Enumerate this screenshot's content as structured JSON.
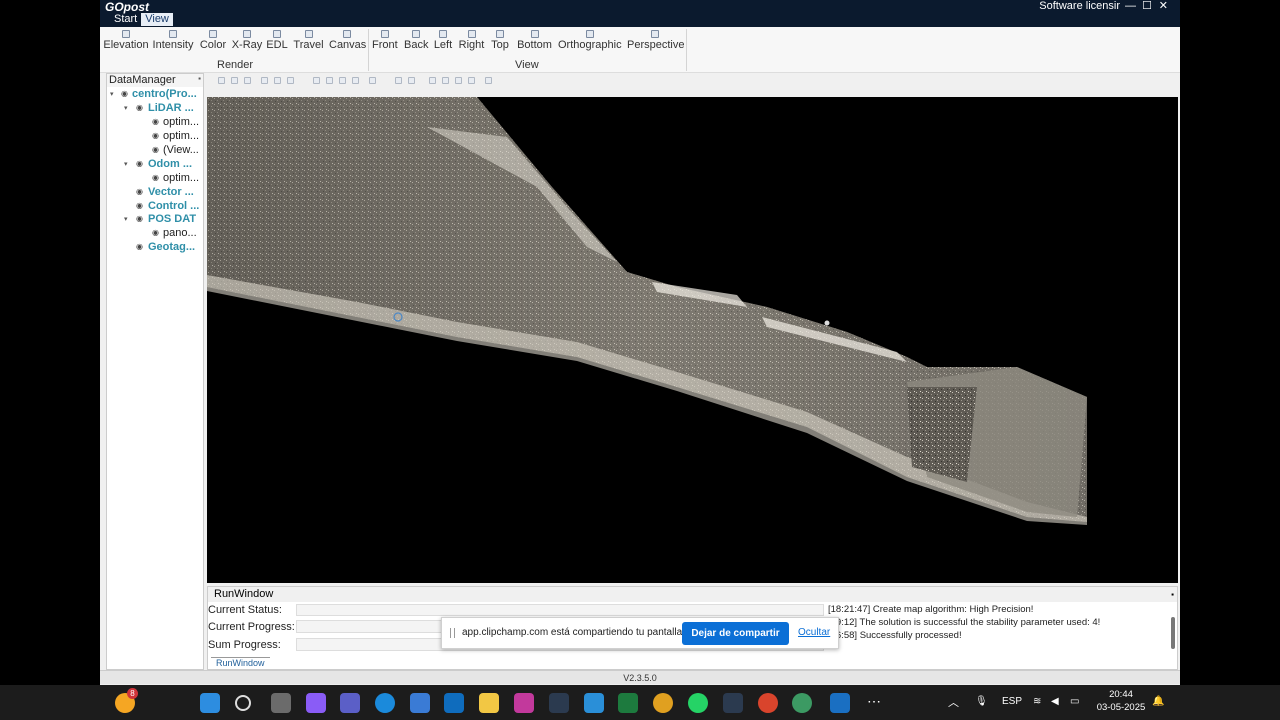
{
  "app": {
    "title": "GOpost",
    "license": "Software licensir",
    "version": "V2.3.5.0"
  },
  "menu_tabs": [
    {
      "label": "Start"
    },
    {
      "label": "View"
    }
  ],
  "ribbon": {
    "render_group_label": "Render",
    "view_group_label": "View",
    "render_buttons": [
      {
        "label": "Elevation",
        "icon": "elevation-icon"
      },
      {
        "label": "Intensity",
        "icon": "intensity-icon"
      },
      {
        "label": "Color",
        "icon": "color-icon"
      },
      {
        "label": "X-Ray",
        "icon": "xray-icon"
      },
      {
        "label": "EDL",
        "icon": "edl-icon"
      },
      {
        "label": "Travel",
        "icon": "travel-icon"
      },
      {
        "label": "Canvas",
        "icon": "canvas-icon"
      }
    ],
    "view_buttons": [
      {
        "label": "Front",
        "icon": "front-view-icon"
      },
      {
        "label": "Back",
        "icon": "back-view-icon"
      },
      {
        "label": "Left",
        "icon": "left-view-icon"
      },
      {
        "label": "Right",
        "icon": "right-view-icon"
      },
      {
        "label": "Top",
        "icon": "top-view-icon"
      },
      {
        "label": "Bottom",
        "icon": "bottom-view-icon"
      },
      {
        "label": "Orthographic",
        "icon": "orthographic-icon"
      },
      {
        "label": "Perspective",
        "icon": "perspective-icon"
      }
    ]
  },
  "data_manager": {
    "title": "DataManager",
    "items": [
      {
        "label": "centro(Pro...",
        "bold": true
      },
      {
        "label": "LiDAR ...",
        "bold": true
      },
      {
        "label": "optim...",
        "bold": false
      },
      {
        "label": "optim...",
        "bold": false
      },
      {
        "label": "(View...",
        "bold": false
      },
      {
        "label": "Odom ...",
        "bold": true
      },
      {
        "label": "optim...",
        "bold": false
      },
      {
        "label": "Vector ...",
        "bold": true
      },
      {
        "label": "Control ...",
        "bold": true
      },
      {
        "label": "POS DAT",
        "bold": true
      },
      {
        "label": "pano...",
        "bold": false
      },
      {
        "label": "Geotag...",
        "bold": true
      }
    ]
  },
  "run_window": {
    "title": "RunWindow",
    "current_status_label": "Current Status",
    "current_progress_label": "Current Progress",
    "sum_progress_label": "Sum Progress",
    "log": [
      "[18:21:47] Create map algorithm: High Precision!",
      ":29:12] The solution is successful the stability parameter used: 4!",
      ":46:58] Successfully processed!"
    ],
    "tab_label": "RunWindow"
  },
  "share_bar": {
    "message": "app.clipchamp.com está compartiendo tu pantalla.",
    "stop_label": "Dejar de compartir",
    "hide_label": "Ocultar"
  },
  "taskbar": {
    "notification_count": "8",
    "language": "ESP",
    "time": "20:44",
    "date": "03-05-2025"
  }
}
